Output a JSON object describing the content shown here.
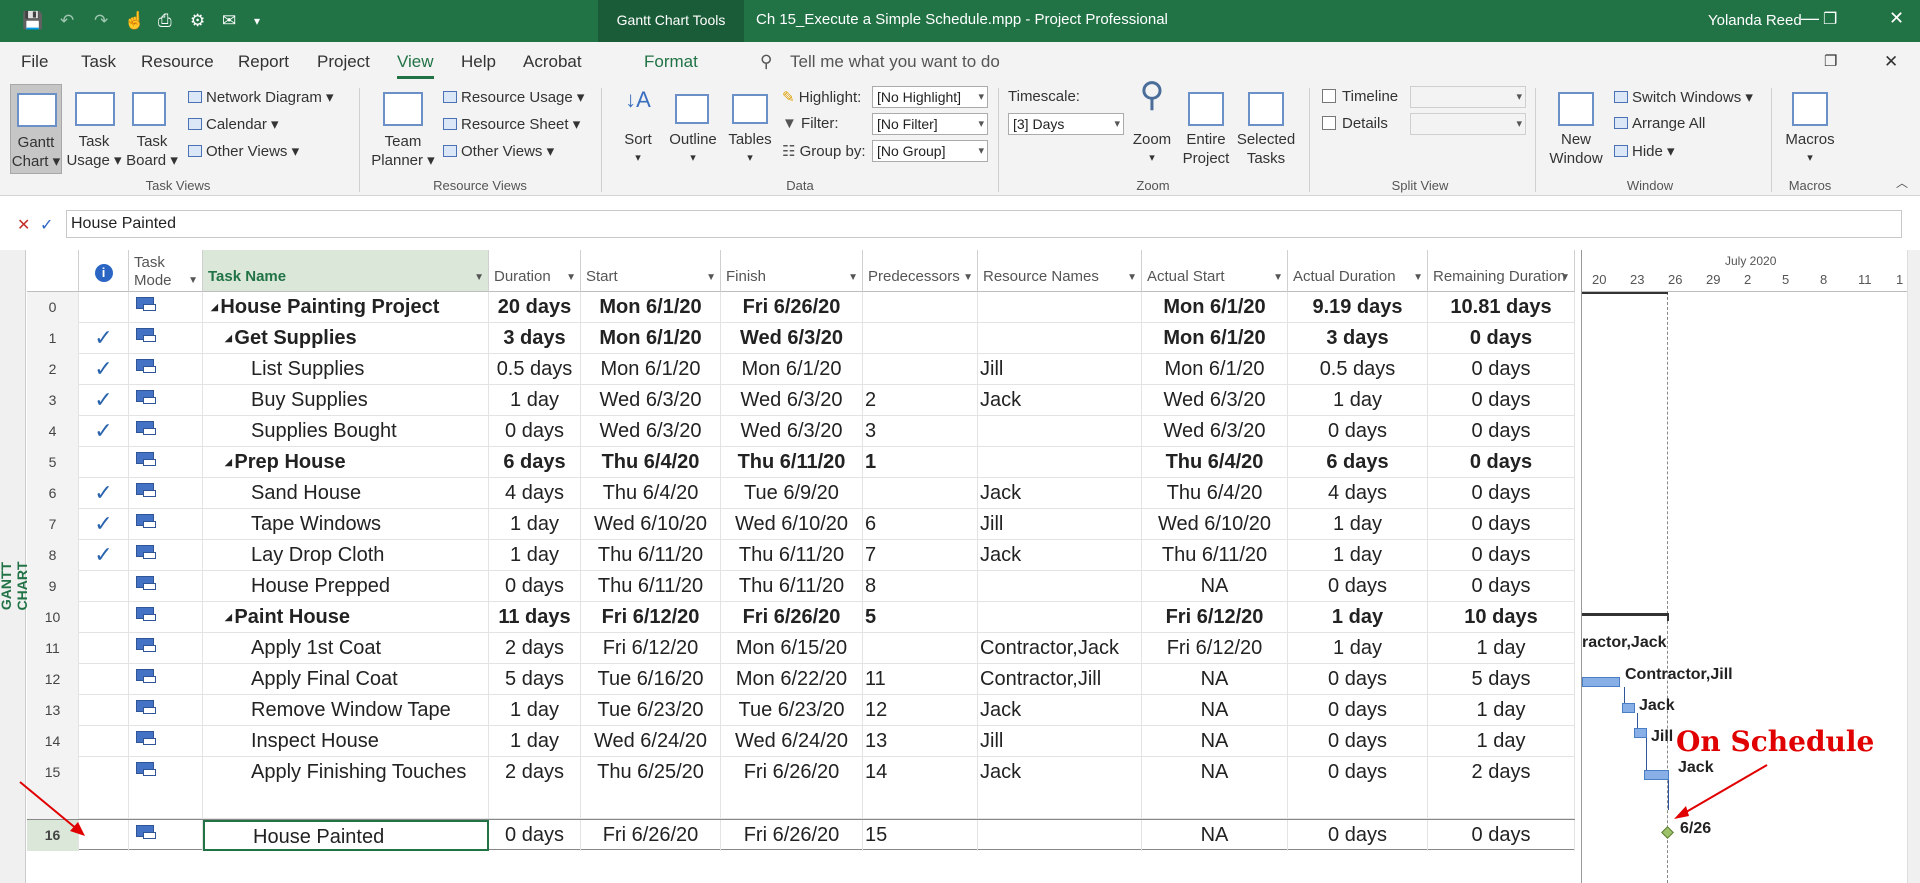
{
  "titlebar": {
    "context_tab": "Gantt Chart Tools",
    "title": "Ch 15_Execute a Simple Schedule.mpp  -  Project Professional",
    "user": "Yolanda Reed"
  },
  "menu": {
    "file": "File",
    "task": "Task",
    "resource": "Resource",
    "report": "Report",
    "project": "Project",
    "view": "View",
    "help": "Help",
    "acrobat": "Acrobat",
    "format": "Format",
    "tell_me": "Tell me what you want to do"
  },
  "ribbon": {
    "gantt_chart": "Gantt\nChart ▾",
    "gantt_chart_l1": "Gantt",
    "gantt_chart_l2": "Chart ▾",
    "task_usage_l1": "Task",
    "task_usage_l2": "Usage ▾",
    "task_board_l1": "Task",
    "task_board_l2": "Board ▾",
    "network_diagram": "Network Diagram ▾",
    "calendar": "Calendar ▾",
    "other_views": "Other Views ▾",
    "task_views": "Task Views",
    "team_planner_l1": "Team",
    "team_planner_l2": "Planner ▾",
    "resource_usage": "Resource Usage ▾",
    "resource_sheet": "Resource Sheet ▾",
    "other_views2": "Other Views ▾",
    "resource_views": "Resource Views",
    "sort": "Sort",
    "outline": "Outline",
    "tables": "Tables",
    "highlight_label": "Highlight:",
    "highlight_value": "[No Highlight]",
    "filter_label": "Filter:",
    "filter_value": "[No Filter]",
    "groupby_label": "Group by:",
    "groupby_value": "[No Group]",
    "data": "Data",
    "timescale_label": "Timescale:",
    "timescale_value": "[3] Days",
    "zoom": "Zoom",
    "entire_project_l1": "Entire",
    "entire_project_l2": "Project",
    "selected_tasks_l1": "Selected",
    "selected_tasks_l2": "Tasks",
    "zoom_group": "Zoom",
    "timeline": "Timeline",
    "details": "Details",
    "split_view": "Split View",
    "new_window_l1": "New",
    "new_window_l2": "Window",
    "switch_windows": "Switch Windows ▾",
    "arrange_all": "Arrange All",
    "hide": "Hide ▾",
    "window": "Window",
    "macros": "Macros",
    "macros_group": "Macros"
  },
  "entry": {
    "value": "House Painted"
  },
  "viewbar": {
    "label": "GANTT CHART"
  },
  "columns": {
    "task_mode": "Task Mode",
    "task_name": "Task Name",
    "duration": "Duration",
    "start": "Start",
    "finish": "Finish",
    "predecessors": "Predecessors",
    "resource_names": "Resource Names",
    "actual_start": "Actual Start",
    "actual_duration": "Actual Duration",
    "remaining_duration": "Remaining Duration"
  },
  "timescale": {
    "month": "July 2020",
    "days": [
      "20",
      "23",
      "26",
      "29",
      "2",
      "5",
      "8",
      "11",
      "1"
    ]
  },
  "tasks": [
    {
      "id": "0",
      "check": "",
      "name": "House Painting Project",
      "summary": true,
      "level": 0,
      "duration": "20 days",
      "start": "Mon 6/1/20",
      "finish": "Fri 6/26/20",
      "pred": "",
      "res": "",
      "astart": "Mon 6/1/20",
      "adur": "9.19 days",
      "rdur": "10.81 days"
    },
    {
      "id": "1",
      "check": "✓",
      "name": "Get Supplies",
      "summary": true,
      "level": 1,
      "duration": "3 days",
      "start": "Mon 6/1/20",
      "finish": "Wed 6/3/20",
      "pred": "",
      "res": "",
      "astart": "Mon 6/1/20",
      "adur": "3 days",
      "rdur": "0 days"
    },
    {
      "id": "2",
      "check": "✓",
      "name": "List Supplies",
      "summary": false,
      "level": 2,
      "duration": "0.5 days",
      "start": "Mon 6/1/20",
      "finish": "Mon 6/1/20",
      "pred": "",
      "res": "Jill",
      "astart": "Mon 6/1/20",
      "adur": "0.5 days",
      "rdur": "0 days"
    },
    {
      "id": "3",
      "check": "✓",
      "name": "Buy Supplies",
      "summary": false,
      "level": 2,
      "duration": "1 day",
      "start": "Wed 6/3/20",
      "finish": "Wed 6/3/20",
      "pred": "2",
      "res": "Jack",
      "astart": "Wed 6/3/20",
      "adur": "1 day",
      "rdur": "0 days"
    },
    {
      "id": "4",
      "check": "✓",
      "name": "Supplies Bought",
      "summary": false,
      "level": 2,
      "duration": "0 days",
      "start": "Wed 6/3/20",
      "finish": "Wed 6/3/20",
      "pred": "3",
      "res": "",
      "astart": "Wed 6/3/20",
      "adur": "0 days",
      "rdur": "0 days"
    },
    {
      "id": "5",
      "check": "",
      "name": "Prep House",
      "summary": true,
      "level": 1,
      "duration": "6 days",
      "start": "Thu 6/4/20",
      "finish": "Thu 6/11/20",
      "pred": "1",
      "res": "",
      "astart": "Thu 6/4/20",
      "adur": "6 days",
      "rdur": "0 days"
    },
    {
      "id": "6",
      "check": "✓",
      "name": "Sand House",
      "summary": false,
      "level": 2,
      "duration": "4 days",
      "start": "Thu 6/4/20",
      "finish": "Tue 6/9/20",
      "pred": "",
      "res": "Jack",
      "astart": "Thu 6/4/20",
      "adur": "4 days",
      "rdur": "0 days"
    },
    {
      "id": "7",
      "check": "✓",
      "name": "Tape Windows",
      "summary": false,
      "level": 2,
      "duration": "1 day",
      "start": "Wed 6/10/20",
      "finish": "Wed 6/10/20",
      "pred": "6",
      "res": "Jill",
      "astart": "Wed 6/10/20",
      "adur": "1 day",
      "rdur": "0 days"
    },
    {
      "id": "8",
      "check": "✓",
      "name": "Lay Drop Cloth",
      "summary": false,
      "level": 2,
      "duration": "1 day",
      "start": "Thu 6/11/20",
      "finish": "Thu 6/11/20",
      "pred": "7",
      "res": "Jack",
      "astart": "Thu 6/11/20",
      "adur": "1 day",
      "rdur": "0 days"
    },
    {
      "id": "9",
      "check": "",
      "name": "House Prepped",
      "summary": false,
      "level": 2,
      "duration": "0 days",
      "start": "Thu 6/11/20",
      "finish": "Thu 6/11/20",
      "pred": "8",
      "res": "",
      "astart": "NA",
      "adur": "0 days",
      "rdur": "0 days"
    },
    {
      "id": "10",
      "check": "",
      "name": "Paint House",
      "summary": true,
      "level": 1,
      "duration": "11 days",
      "start": "Fri 6/12/20",
      "finish": "Fri 6/26/20",
      "pred": "5",
      "res": "",
      "astart": "Fri 6/12/20",
      "adur": "1 day",
      "rdur": "10 days"
    },
    {
      "id": "11",
      "check": "",
      "name": "Apply 1st Coat",
      "summary": false,
      "level": 2,
      "duration": "2 days",
      "start": "Fri 6/12/20",
      "finish": "Mon 6/15/20",
      "pred": "",
      "res": "Contractor,Jack",
      "astart": "Fri 6/12/20",
      "adur": "1 day",
      "rdur": "1 day"
    },
    {
      "id": "12",
      "check": "",
      "name": "Apply Final Coat",
      "summary": false,
      "level": 2,
      "duration": "5 days",
      "start": "Tue 6/16/20",
      "finish": "Mon 6/22/20",
      "pred": "11",
      "res": "Contractor,Jill",
      "astart": "NA",
      "adur": "0 days",
      "rdur": "5 days"
    },
    {
      "id": "13",
      "check": "",
      "name": "Remove Window Tape",
      "summary": false,
      "level": 2,
      "duration": "1 day",
      "start": "Tue 6/23/20",
      "finish": "Tue 6/23/20",
      "pred": "12",
      "res": "Jack",
      "astart": "NA",
      "adur": "0 days",
      "rdur": "1 day"
    },
    {
      "id": "14",
      "check": "",
      "name": "Inspect House",
      "summary": false,
      "level": 2,
      "duration": "1 day",
      "start": "Wed 6/24/20",
      "finish": "Wed 6/24/20",
      "pred": "13",
      "res": "Jill",
      "astart": "NA",
      "adur": "0 days",
      "rdur": "1 day"
    },
    {
      "id": "15",
      "check": "",
      "name": "Apply Finishing Touches",
      "summary": false,
      "level": 2,
      "duration": "2 days",
      "start": "Thu 6/25/20",
      "finish": "Fri 6/26/20",
      "pred": "14",
      "res": "Jack",
      "astart": "NA",
      "adur": "0 days",
      "rdur": "2 days"
    },
    {
      "id": "16",
      "check": "",
      "name": "House Painted",
      "summary": false,
      "level": 2,
      "duration": "0 days",
      "start": "Fri 6/26/20",
      "finish": "Fri 6/26/20",
      "pred": "15",
      "res": "",
      "astart": "NA",
      "adur": "0 days",
      "rdur": "0 days"
    }
  ],
  "chart_labels": {
    "l11": "ractor,Jack",
    "l12": "Contractor,Jill",
    "l13": "Jack",
    "l14": "Jill",
    "l15": "Jack",
    "l16": "6/26",
    "annotation": "On Schedule"
  },
  "colors": {
    "accent": "#217346",
    "bar": "#88b0e6",
    "annotation": "#e00000"
  }
}
